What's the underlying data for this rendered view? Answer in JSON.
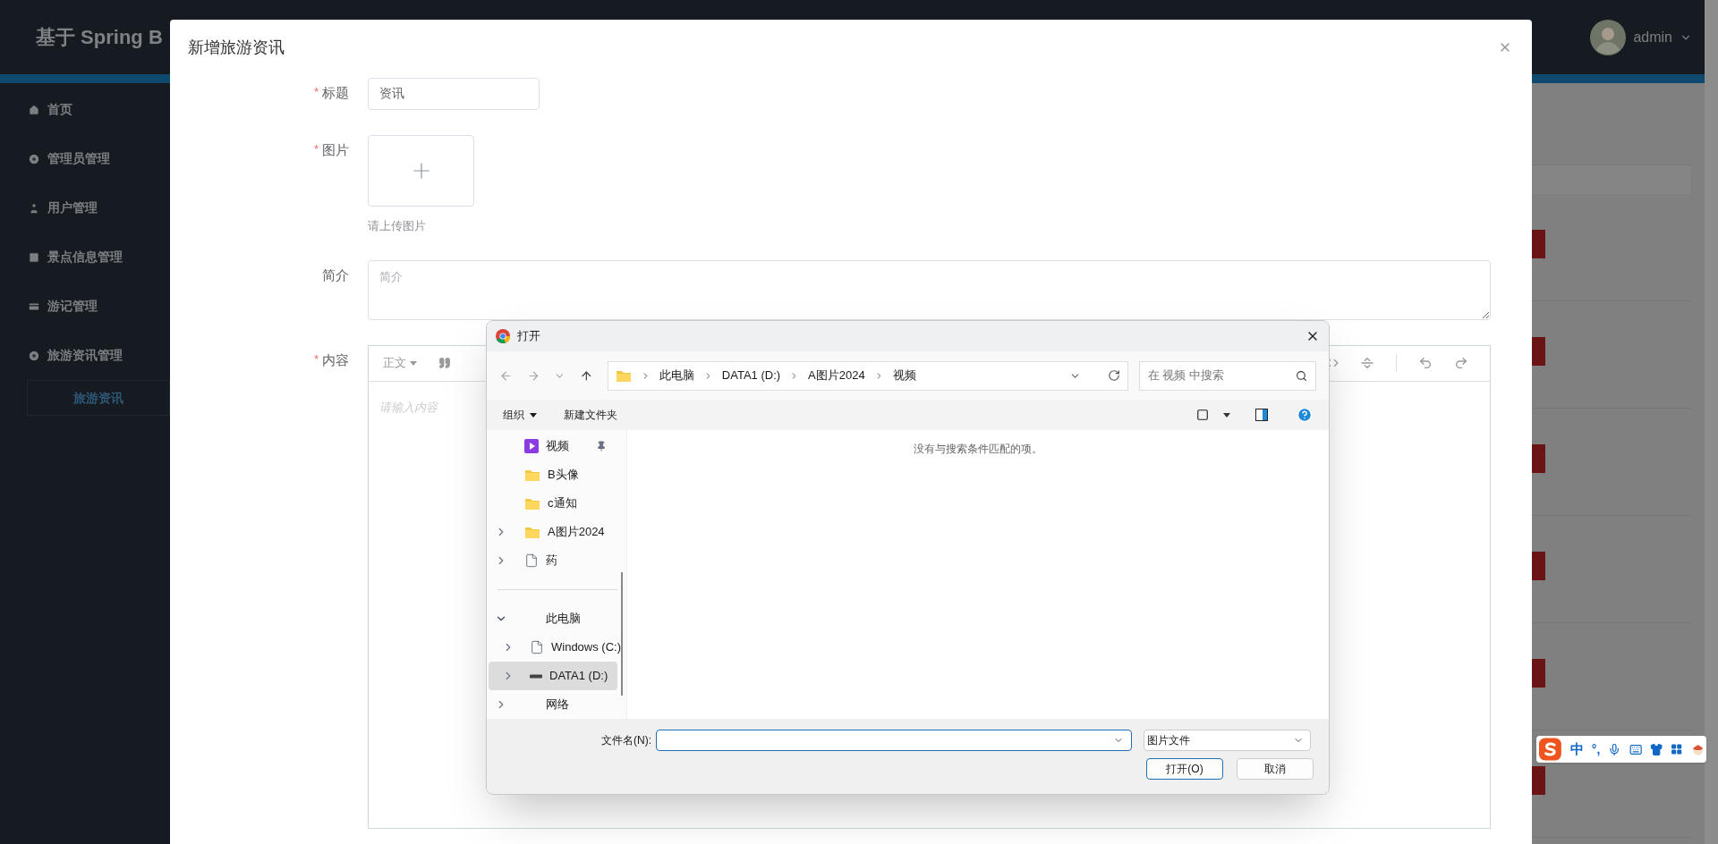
{
  "header": {
    "title": "基于 Spring B",
    "user": "admin"
  },
  "sidebar": {
    "items": [
      {
        "label": "首页",
        "selected": false
      },
      {
        "label": "管理员管理",
        "selected": false
      },
      {
        "label": "用户管理",
        "selected": false
      },
      {
        "label": "景点信息管理",
        "selected": false
      },
      {
        "label": "游记管理",
        "selected": false
      },
      {
        "label": "旅游资讯管理",
        "selected": false,
        "children": [
          {
            "label": "旅游资讯",
            "selected": true
          }
        ]
      }
    ]
  },
  "modal": {
    "title": "新增旅游资讯",
    "fields": [
      {
        "kind": "text",
        "label": "标题",
        "required_mark": "*",
        "value": "资讯"
      },
      {
        "kind": "upload",
        "label": "图片",
        "required_mark": "*",
        "hint": "请上传图片"
      },
      {
        "kind": "textarea",
        "label": "简介",
        "placeholder": "简介"
      },
      {
        "kind": "editor",
        "label": "内容",
        "required_mark": "*",
        "format": "正文",
        "placeholder": "请输入内容"
      }
    ]
  },
  "file_dialog": {
    "title": "打开",
    "breadcrumb": [
      "此电脑",
      "DATA1 (D:)",
      "A图片2024",
      "视频"
    ],
    "search_placeholder": "在 视频 中搜索",
    "toolbar": [
      {
        "label": "组织",
        "dropdown": true
      },
      {
        "label": "新建文件夹",
        "dropdown": false
      }
    ],
    "quick_access": [
      {
        "kind": "video",
        "label": "视频",
        "pinned": true,
        "expandable": false,
        "selected": false
      },
      {
        "kind": "folder",
        "label": "B头像",
        "pinned": false,
        "expandable": false,
        "selected": false
      },
      {
        "kind": "folder",
        "label": "c通知",
        "pinned": false,
        "expandable": false,
        "selected": false
      },
      {
        "kind": "folder",
        "label": "A图片2024",
        "pinned": false,
        "expandable": true,
        "expanded": false,
        "selected": false
      },
      {
        "kind": "file",
        "label": "药",
        "pinned": false,
        "expandable": true,
        "expanded": false,
        "selected": false
      }
    ],
    "tree": [
      {
        "label": "此电脑",
        "expandable": true,
        "expanded": true,
        "selected": false,
        "children": [
          {
            "kind": "file",
            "label": "Windows (C:)",
            "expandable": true,
            "expanded": false,
            "selected": false
          },
          {
            "kind": "drive",
            "label": "DATA1 (D:)",
            "expandable": true,
            "expanded": false,
            "selected": true
          }
        ]
      },
      {
        "label": "网络",
        "expandable": true,
        "expanded": false,
        "selected": false
      }
    ],
    "empty_message": "没有与搜索条件匹配的项。",
    "filename_label": "文件名(N):",
    "filetype": "图片文件",
    "buttons": [
      {
        "label": "打开(O)",
        "primary": true
      },
      {
        "label": "取消",
        "primary": false
      }
    ]
  },
  "ime": {
    "mode": "中",
    "punct": "°,"
  }
}
